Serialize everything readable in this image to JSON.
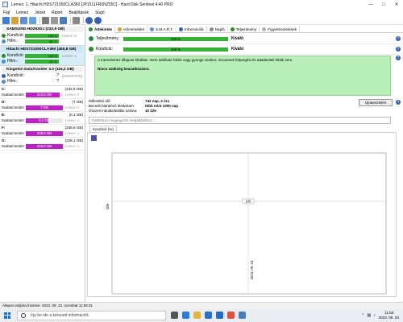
{
  "window": {
    "title": "Lemez: 1, Hitachi HDS721050CLA360 [JP1511FR0NZ55C] - Hard Disk Sentinel 4.40 PRO"
  },
  "menu": [
    "Fájl",
    "Lemez",
    "Jelzet",
    "Riport",
    "Beállítások",
    "Súgó"
  ],
  "tabs": [
    "Áttekintés",
    "Hőmérséklet",
    "S.M.A.R.T.",
    "Információk",
    "Napló",
    "Teljesítmény",
    "Figyelmeztetések"
  ],
  "disks": [
    {
      "name": "SAMSUNG HD253GJ (232,9 GB)",
      "health_label": "Kondíció:",
      "health": "100 %",
      "health_pct": 100,
      "temp_label": "Hőm.:",
      "temp": "30 °C",
      "disk_ref": "Lemez: 0"
    },
    {
      "name": "Hitachi HDS721050CLA360 (465,8 GB)",
      "health_label": "Kondíció:",
      "health": "100 %",
      "health_pct": 100,
      "temp_label": "Hőm.:",
      "temp": "24 °C",
      "disk_ref": "Lemez: 1"
    },
    {
      "name": "Kingston DataTraveler 3.0 (115,2 GB)",
      "health_label": "Kondíció:",
      "health": "?",
      "health_pct": 0,
      "temp_label": "Hőm.:",
      "temp": "?",
      "disk_ref": "[KINGSTON]"
    }
  ],
  "volumes": [
    {
      "letter": "C:",
      "size": "(232,9 GB)",
      "free_label": "Szabad terület",
      "free": "212,5 GB",
      "free_pct": 91,
      "disk_ref": "Lemez: 0"
    },
    {
      "letter": "D:",
      "size": "(7 GB)",
      "free_label": "Szabad terület",
      "free": "7 GB",
      "free_pct": 100,
      "disk_ref": "Lemez: 2"
    },
    {
      "letter": "E:",
      "size": "(0,1 GB)",
      "free_label": "Szabad terület",
      "free": "0,1 GB",
      "free_pct": 60,
      "disk_ref": "Lemez: 1"
    },
    {
      "letter": "F:",
      "size": "(238,6 GB)",
      "free_label": "Szabad terület",
      "free": "239,5 GB",
      "free_pct": 99,
      "disk_ref": "Lemez: 1"
    },
    {
      "letter": "G:",
      "size": "(226,1 GB)",
      "free_label": "Szabad terület",
      "free": "226,0 GB",
      "free_pct": 99,
      "disk_ref": "Lemez: 1"
    }
  ],
  "overview": {
    "performance_label": "Teljesítmény:",
    "performance": "100 %",
    "performance_pct": 100,
    "performance_rating": "Kiváló",
    "health_label": "Kondíció:",
    "health": "100 %",
    "health_pct": 100,
    "health_rating": "Kiváló",
    "desc_line1": "A merevlemez állapota hibátlan. Nem található hibás vagy gyenge szektor, nincsenek felpörgési és adatátviteli hibák sem.",
    "desc_line2": "Nincs szükség beavatkozásra.",
    "power_on_label": "Működési idő:",
    "power_on": "742 nap, 2 óra",
    "lifetime_label": "Becsült hátralévő élettartam:",
    "lifetime": "több mint 1000 nap",
    "starts_label": "Összes indulás/leállás száma:",
    "starts": "10 225",
    "refresh_button": "Újratesztelés",
    "comment_placeholder": "Kattintson megjegyzés megadásához ..."
  },
  "chart_tabs": [
    "Kondíció (%)"
  ],
  "chart_data": {
    "type": "line",
    "series": [
      {
        "points": [
          {
            "x": "2023. 09. 23.",
            "y": 100
          }
        ]
      }
    ],
    "ylabel_tick": "100",
    "point_label": "100",
    "x_tick": "2023. 09. 23."
  },
  "statusbar": {
    "text": "Állapot utoljára frissítve: 2023. 09. 23. szombat 11:59:31"
  },
  "taskbar": {
    "search_placeholder": "Írja be ide a keresett információt.",
    "time": "11:59",
    "date": "2023. 09. 23."
  },
  "colors": {
    "good": "#34b233",
    "free_space": "#c020c8",
    "description_bg": "#b9f0b9"
  }
}
